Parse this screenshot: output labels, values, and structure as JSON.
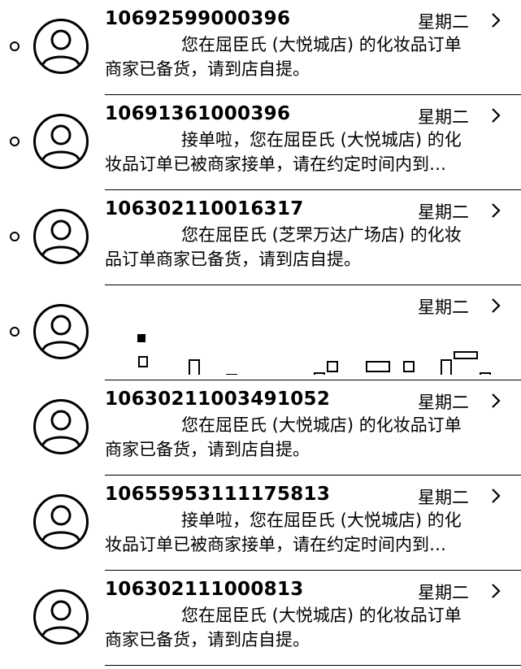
{
  "messages": [
    {
      "sender": "10692599000396",
      "date": "星期二",
      "unread": true,
      "preview_line1": "您在屈臣氏 (大悦城店) 的化妆品订单",
      "preview_line2": "商家已备货，请到店自提。",
      "avatar_icon": "person-avatar-icon"
    },
    {
      "sender": "10691361000396",
      "date": "星期二",
      "unread": true,
      "preview_line1": "接单啦，您在屈臣氏 (大悦城店) 的化",
      "preview_line2": "妆品订单已被商家接单，请在约定时间内到…",
      "avatar_icon": "person-avatar-icon"
    },
    {
      "sender": "106302110016317",
      "date": "星期二",
      "unread": true,
      "preview_line1": "您在屈臣氏 (芝罘万达广场店) 的化妆",
      "preview_line2": "品订单商家已备货，请到店自提。",
      "avatar_icon": "person-avatar-icon"
    },
    {
      "sender": "",
      "date": "星期二",
      "unread": true,
      "preview_line1": "",
      "preview_line2": "",
      "avatar_icon": "person-avatar-icon"
    },
    {
      "sender": "10630211003491052",
      "date": "星期二",
      "unread": false,
      "preview_line1": "您在屈臣氏 (大悦城店) 的化妆品订单",
      "preview_line2": "商家已备货，请到店自提。",
      "avatar_icon": "person-avatar-icon"
    },
    {
      "sender": "10655953111175813",
      "date": "星期二",
      "unread": false,
      "preview_line1": "接单啦，您在屈臣氏 (大悦城店) 的化",
      "preview_line2": "妆品订单已被商家接单，请在约定时间内到…",
      "avatar_icon": "person-avatar-icon"
    },
    {
      "sender": "106302111000813",
      "date": "星期二",
      "unread": false,
      "preview_line1": "您在屈臣氏 (大悦城店) 的化妆品订单",
      "preview_line2": "商家已备货，请到店自提。",
      "avatar_icon": "person-avatar-icon"
    }
  ],
  "chevron_icon": "chevron-right-icon",
  "colors": {
    "text": "#000000",
    "background": "#ffffff",
    "separator": "#000000"
  }
}
